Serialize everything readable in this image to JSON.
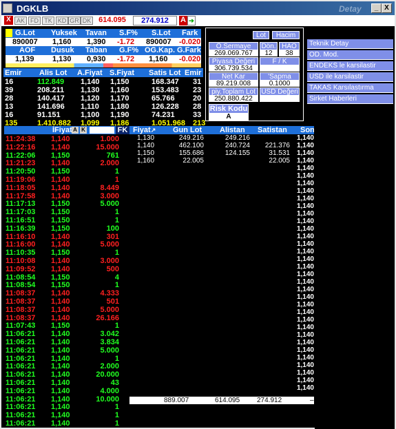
{
  "window": {
    "title": "DGKLB",
    "watermark": "Detay",
    "min": "_",
    "max": "□",
    "close": "X"
  },
  "toolbar": {
    "close": "X",
    "tabs": [
      "AK",
      "FD",
      "TK",
      "KD",
      "GR",
      "DK"
    ],
    "value1": "614.095",
    "value2": "274.912",
    "a_label": "A"
  },
  "summary": {
    "headers1": [
      "G.Lot",
      "Yuksek",
      "Tavan",
      "S.F%",
      "S.Lot",
      "Fark"
    ],
    "values1": [
      "890007",
      "1,160",
      "1,390",
      "-1.72",
      "890007",
      "-0.020"
    ],
    "headers2": [
      "AOF",
      "Dusuk",
      "Taban",
      "G.F%",
      "OG.Kap.",
      "G.Fark"
    ],
    "values2": [
      "1,139",
      "1,130",
      "0,930",
      "-1.72",
      "1,160",
      "-0.020"
    ]
  },
  "depth": {
    "headers": [
      "Emir",
      "Alis Lot",
      "A.Fiyat",
      "S.Fiyat",
      "Satis Lot",
      "Emir"
    ],
    "rows": [
      [
        "16",
        "112.849",
        "1,140",
        "1,150",
        "168.347",
        "31"
      ],
      [
        "39",
        "208.211",
        "1,130",
        "1,160",
        "153.483",
        "23"
      ],
      [
        "28",
        "140.417",
        "1,120",
        "1,170",
        "65.766",
        "20"
      ],
      [
        "13",
        "141.696",
        "1,110",
        "1,180",
        "126.228",
        "28"
      ],
      [
        "16",
        "91.151",
        "1,100",
        "1,190",
        "74.231",
        "33"
      ]
    ],
    "totals": [
      "135",
      "1.410.882",
      "1,099",
      "1,186",
      "1.051.968",
      "213"
    ]
  },
  "panel": {
    "lot": "Lot",
    "hacim": "Hacim",
    "o_sermaye": "Ö.Sermaye",
    "o_sermaye_val": "269.069.767",
    "don": "Dön.",
    "don_val": "12",
    "hao": "HAO",
    "hao_val": "38",
    "piyasa": "Piyasa Değeri",
    "piyasa_val": "306.739.534",
    "fk": "F / K",
    "fk_val": "",
    "netkar": "Net Kar",
    "netkar_val": "89.219.008",
    "sapma": "'Sapma",
    "sapma_val": "0.1000",
    "piy_toplam": "piy.Toplam Lot",
    "piy_toplam_val": "250.880.422",
    "usd": "USD Değeri",
    "usd_val": "",
    "risk": "Risk Kodu",
    "risk_val": "A"
  },
  "links": [
    "Teknik Detay",
    "OD. Mod.",
    "ENDEKS le karsilastir",
    "USD ile karsilastir",
    "TAKAS Karsılastırma",
    "Sirket Haberleri"
  ],
  "trades_header": {
    "col1": "",
    "col2": "İFiyat",
    "a": "A",
    "k": "K",
    "fk": "FK"
  },
  "trades": [
    [
      "11:24:38",
      "1,140",
      "1.000",
      "r"
    ],
    [
      "11:22:16",
      "1,140",
      "15.000",
      "r"
    ],
    [
      "11:22:06",
      "1,150",
      "761",
      "g"
    ],
    [
      "11:21:23",
      "1,140",
      "2.000",
      "r"
    ],
    [
      "11:20:50",
      "1,150",
      "1",
      "g"
    ],
    [
      "11:19:06",
      "1,140",
      "1",
      "r"
    ],
    [
      "11:18:05",
      "1,140",
      "8.449",
      "r"
    ],
    [
      "11:17:58",
      "1,140",
      "3.000",
      "r"
    ],
    [
      "11:17:13",
      "1,150",
      "5.000",
      "g"
    ],
    [
      "11:17:03",
      "1,150",
      "1",
      "g"
    ],
    [
      "11:16:51",
      "1,150",
      "1",
      "g"
    ],
    [
      "11:16:39",
      "1,150",
      "100",
      "g"
    ],
    [
      "11:16:10",
      "1,140",
      "301",
      "r"
    ],
    [
      "11:16:00",
      "1,140",
      "5.000",
      "r"
    ],
    [
      "11:10:35",
      "1,150",
      "1",
      "g"
    ],
    [
      "11:10:08",
      "1,140",
      "3.000",
      "r"
    ],
    [
      "11:09:52",
      "1,140",
      "500",
      "r"
    ],
    [
      "11:08:54",
      "1,150",
      "4",
      "g"
    ],
    [
      "11:08:54",
      "1,150",
      "1",
      "g"
    ],
    [
      "11:08:37",
      "1,140",
      "4.333",
      "r"
    ],
    [
      "11:08:37",
      "1,140",
      "501",
      "r"
    ],
    [
      "11:08:37",
      "1,140",
      "5.000",
      "r"
    ],
    [
      "11:08:37",
      "1,140",
      "26.166",
      "r"
    ],
    [
      "11:07:43",
      "1,150",
      "1",
      "g"
    ],
    [
      "11:06:21",
      "1,140",
      "3.042",
      "g"
    ],
    [
      "11:06:21",
      "1,140",
      "3.834",
      "g"
    ],
    [
      "11:06:21",
      "1,140",
      "5.000",
      "g"
    ],
    [
      "11:06:21",
      "1,140",
      "1",
      "g"
    ],
    [
      "11:06:21",
      "1,140",
      "2.000",
      "g"
    ],
    [
      "11:06:21",
      "1,140",
      "20.000",
      "g"
    ],
    [
      "11:06:21",
      "1,140",
      "43",
      "g"
    ],
    [
      "11:06:21",
      "1,140",
      "4.000",
      "g"
    ],
    [
      "11:06:21",
      "1,140",
      "10.000",
      "g"
    ],
    [
      "11:06:21",
      "1,140",
      "1",
      "g"
    ],
    [
      "11:06:21",
      "1,140",
      "1",
      "g"
    ],
    [
      "11:06:21",
      "1,140",
      "1",
      "g"
    ]
  ],
  "price_header": [
    "Fiyat",
    "Gun Lot",
    "Alistan",
    "Satistan",
    "Son"
  ],
  "price_rows": [
    [
      "1,130",
      "249.216",
      "249.216",
      ""
    ],
    [
      "1,140",
      "462.100",
      "240.724",
      "221.376"
    ],
    [
      "1,150",
      "155.686",
      "124.155",
      "31.531"
    ],
    [
      "1,160",
      "22.005",
      "",
      "22.005"
    ]
  ],
  "price_totals": [
    "889.007",
    "614.095",
    "274.912"
  ],
  "son_values": [
    "1,140",
    "1,140",
    "1,140",
    "1,140",
    "1,140",
    "1,140",
    "1,140",
    "1,140",
    "1,140",
    "1,140",
    "1,140",
    "1,140",
    "1,140",
    "1,140",
    "1,140",
    "1,140",
    "1,140",
    "1,140",
    "1,140",
    "1,140",
    "1,140",
    "1,140",
    "1,140",
    "1,140",
    "1,140",
    "1,140",
    "1,140",
    "1,140",
    "1,140",
    "1,140",
    "1,140",
    "1,140",
    "1,140",
    "1,140",
    "1,140",
    "1,140",
    "1,140",
    "1,140",
    "1,140",
    "1,140",
    "1,140",
    "1,140",
    "1,140"
  ],
  "colors": {
    "red": "#ff2020",
    "green": "#20ff20",
    "yellow": "#ffff00",
    "blue": "#1e6fd9",
    "link": "#7f8fe8"
  }
}
